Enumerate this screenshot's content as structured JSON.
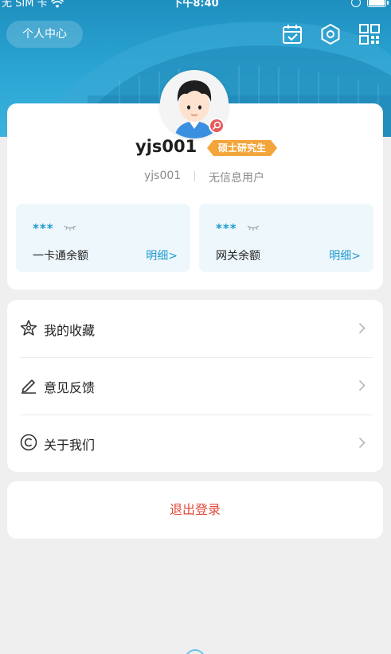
{
  "status_bar": {
    "carrier": "无 SIM 卡",
    "time": "下午8:40"
  },
  "header": {
    "title_button": "个人中心",
    "icons": [
      "calendar-check-icon",
      "settings-hexagon-icon",
      "qr-scan-icon"
    ],
    "background_color": "#2ba6d4"
  },
  "profile": {
    "username": "yjs001",
    "degree_badge": "硕士研究生",
    "account_id": "yjs001",
    "info_text": "无信息用户",
    "badge_color": "#f3a53a"
  },
  "balances": [
    {
      "masked_value": "***",
      "label": "一卡通余额",
      "detail_link": "明细>"
    },
    {
      "masked_value": "***",
      "label": "网关余额",
      "detail_link": "明细>"
    }
  ],
  "menu": {
    "items": [
      {
        "label": "我的收藏",
        "icon": "star-outline-icon"
      },
      {
        "label": "意见反馈",
        "icon": "pencil-icon"
      },
      {
        "label": "关于我们",
        "icon": "copyright-icon"
      }
    ]
  },
  "logout": {
    "label": "退出登录",
    "color": "#e04a3a"
  },
  "accent_color": "#1f9ad1"
}
